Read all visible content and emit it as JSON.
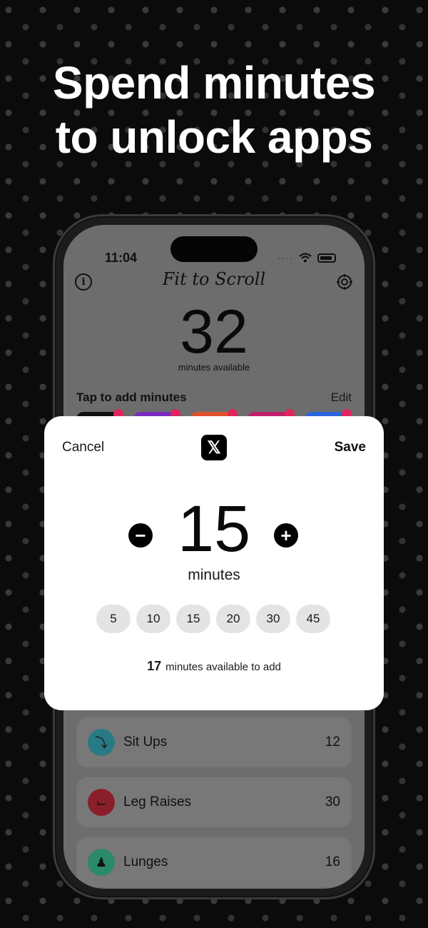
{
  "headline": {
    "line1": "Spend minutes",
    "line2": "to unlock apps"
  },
  "phone": {
    "status_time": "11:04",
    "app_title": "Fit to Scroll",
    "minutes_count": "32",
    "minutes_label": "minutes available",
    "tap_label": "Tap to add minutes",
    "edit_label": "Edit",
    "app_chip_colors": [
      "#111111",
      "#7a2bbf",
      "#e0502a",
      "#c01f6a",
      "#2a66d9"
    ],
    "exercises": [
      {
        "name": "Sit Ups",
        "count": "12",
        "icon": "sit-ups-icon",
        "color": "#2a7a86"
      },
      {
        "name": "Leg Raises",
        "count": "30",
        "icon": "leg-raises-icon",
        "color": "#8a1f2a"
      },
      {
        "name": "Lunges",
        "count": "16",
        "icon": "lunges-icon",
        "color": "#2a8a6a"
      }
    ]
  },
  "modal": {
    "cancel_label": "Cancel",
    "save_label": "Save",
    "app_icon": "x-logo",
    "app_glyph": "𝕏",
    "value": "15",
    "unit_label": "minutes",
    "minus_glyph": "−",
    "plus_glyph": "+",
    "presets": [
      "5",
      "10",
      "15",
      "20",
      "30",
      "45"
    ],
    "available_count": "17",
    "available_text": "minutes available to add"
  }
}
